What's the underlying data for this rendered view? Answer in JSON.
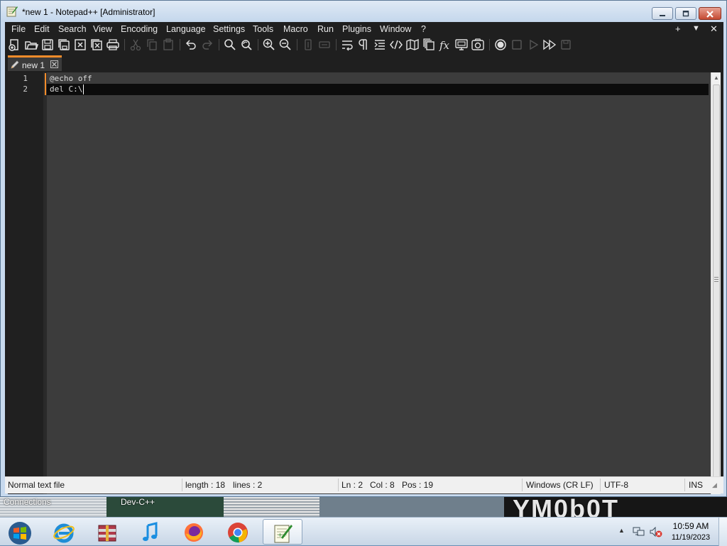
{
  "window": {
    "title": "*new 1 - Notepad++ [Administrator]"
  },
  "menu": {
    "items": [
      "File",
      "Edit",
      "Search",
      "View",
      "Encoding",
      "Language",
      "Settings",
      "Tools",
      "Macro",
      "Run",
      "Plugins",
      "Window",
      "?"
    ],
    "right": [
      "+",
      "▼",
      "✕"
    ]
  },
  "tabs": [
    {
      "label": "new 1",
      "active": true
    }
  ],
  "editor": {
    "lines": [
      {
        "number": "1",
        "text": "@echo off"
      },
      {
        "number": "2",
        "text": "del C:\\"
      }
    ]
  },
  "statusbar": {
    "file_type": "Normal text file",
    "length": "length : 18",
    "lines": "lines : 2",
    "ln": "Ln : 2",
    "col": "Col : 8",
    "pos": "Pos : 19",
    "eol": "Windows (CR LF)",
    "encoding": "UTF-8",
    "mode": "INS"
  },
  "desktop": {
    "labels": [
      "Connections",
      "Dev-C++"
    ],
    "wallpaper_text": "YM0b0T"
  },
  "taskbar": {
    "time": "10:59 AM",
    "date": "11/19/2023"
  },
  "colors": {
    "accent": "#f58c2a",
    "editor_bg": "#3c3c3c",
    "gutter_bg": "#202020",
    "caret_line_bg": "#0c0c0c",
    "menu_bg": "#1f1f1f"
  }
}
